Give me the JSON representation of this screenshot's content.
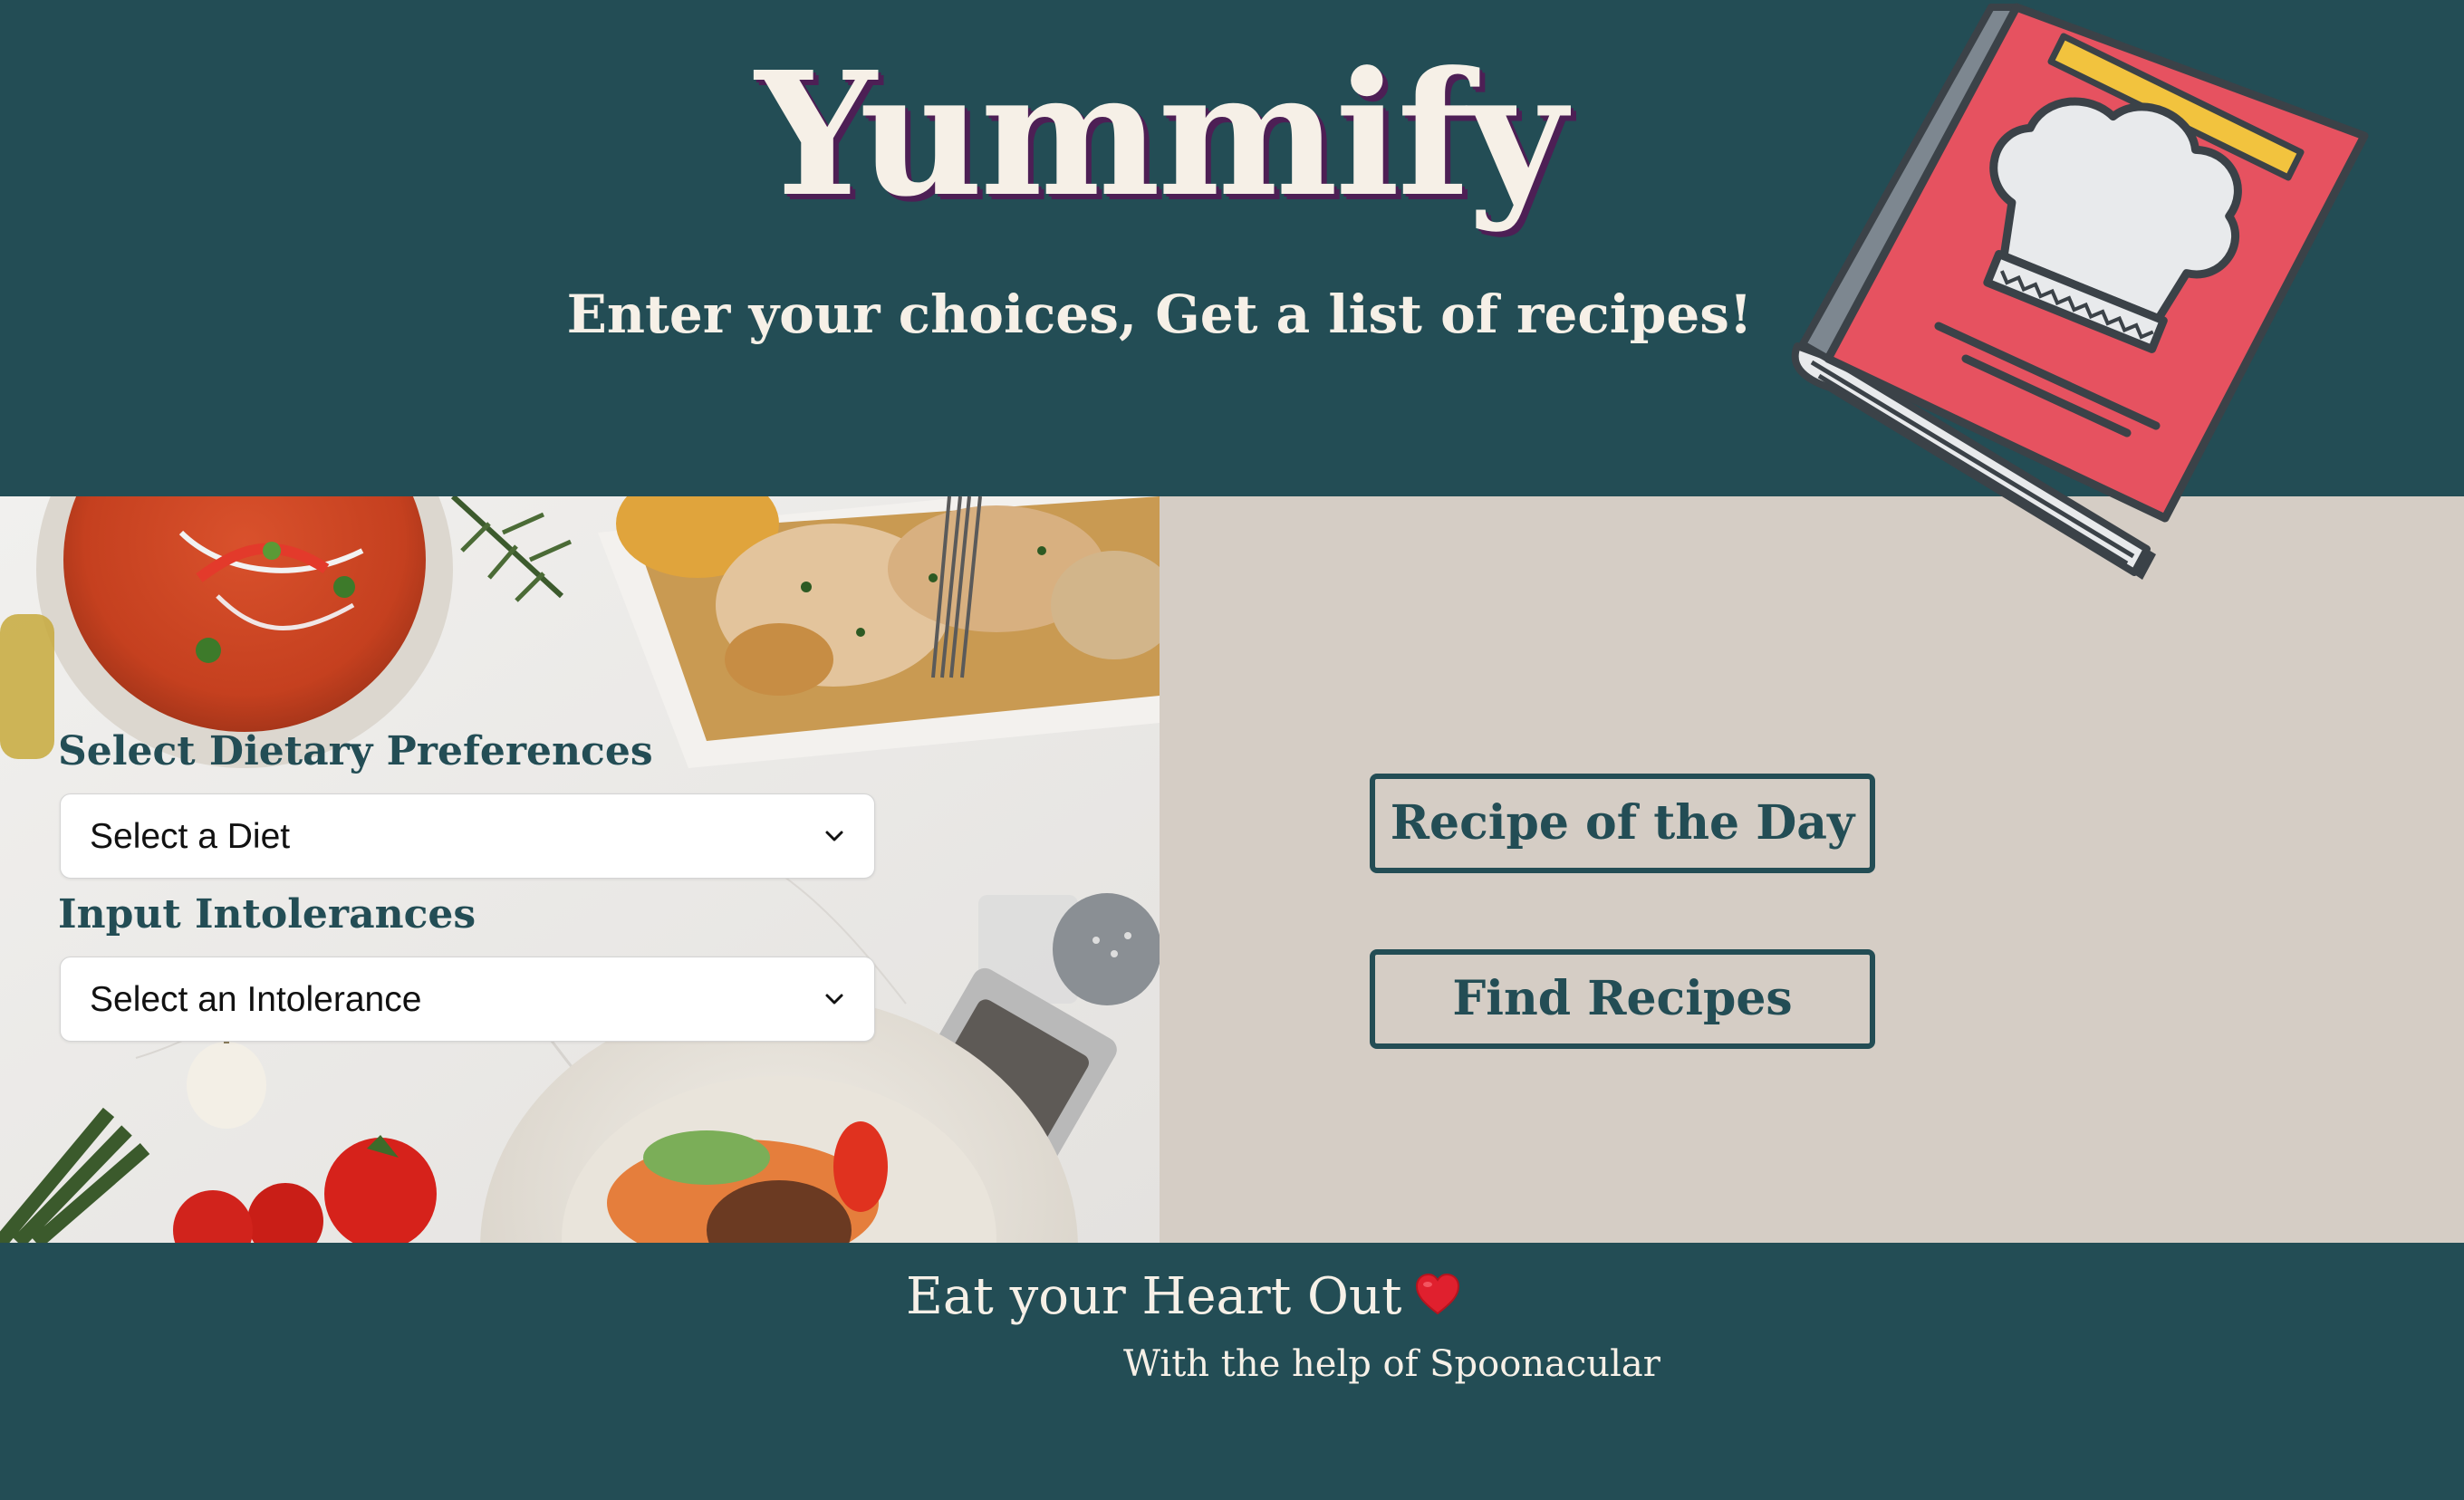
{
  "header": {
    "title": "Yummify",
    "tagline": "Enter your choices, Get a list of recipes!"
  },
  "form": {
    "diet_label": "Select Dietary Preferences",
    "diet_select": {
      "selected": "Select a Diet"
    },
    "intolerance_label": "Input Intolerances",
    "intolerance_select": {
      "selected": "Select an Intolerance"
    }
  },
  "actions": {
    "recipe_of_day": "Recipe of the Day",
    "find_recipes": "Find Recipes"
  },
  "footer": {
    "main": "Eat your Heart Out",
    "sub": "With the help of Spoonacular"
  },
  "icons": {
    "book": "cookbook-icon",
    "heart": "heart-icon",
    "chevron": "chevron-down-icon"
  },
  "colors": {
    "primary": "#234d55",
    "cream": "#f6f0e7",
    "panel": "#d5cdc5",
    "book_red": "#e65260",
    "title_shadow": "#4d1f55"
  }
}
